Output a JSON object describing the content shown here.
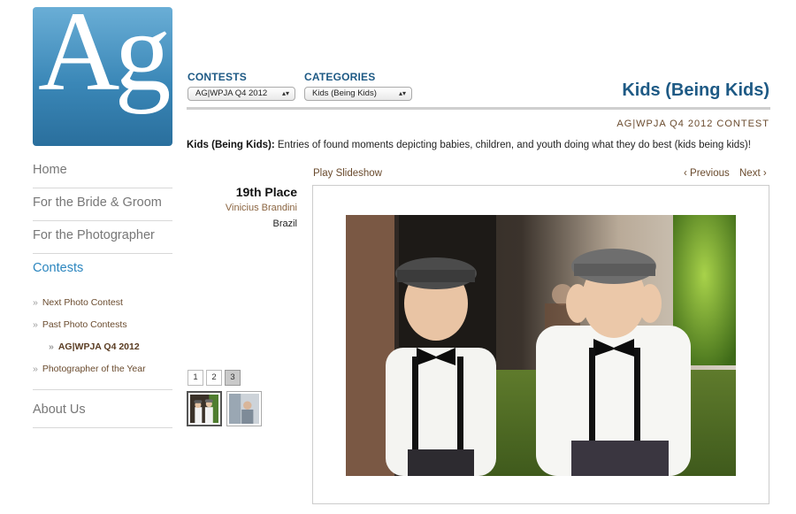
{
  "logo": {
    "text": "Ag"
  },
  "nav": {
    "home": "Home",
    "bride_groom": "For the Bride & Groom",
    "photographer": "For the Photographer",
    "contests": "Contests",
    "next_contest": "Next Photo Contest",
    "past_contests": "Past Photo Contests",
    "current_contest": "AG|WPJA Q4 2012",
    "photographer_year": "Photographer of the Year",
    "about": "About Us"
  },
  "filters": {
    "contests_label": "CONTESTS",
    "contests_value": "AG|WPJA Q4 2012",
    "categories_label": "CATEGORIES",
    "categories_value": "Kids (Being Kids)"
  },
  "category": {
    "title": "Kids (Being Kids)",
    "contest": "AG|WPJA Q4 2012 CONTEST",
    "desc_label": "Kids (Being Kids):",
    "desc_text": "Entries of found moments depicting babies, children, and youth doing what they do best (kids being kids)!"
  },
  "controls": {
    "play": "Play Slideshow",
    "previous": "‹ Previous",
    "next": "Next ›"
  },
  "entry": {
    "place": "19th Place",
    "photographer": "Vinicius Brandini",
    "country": "Brazil"
  },
  "pages": [
    "1",
    "2",
    "3"
  ],
  "colors": {
    "accent": "#1e5a85",
    "link": "#6a4b2e",
    "nav_active": "#2c86bf"
  }
}
